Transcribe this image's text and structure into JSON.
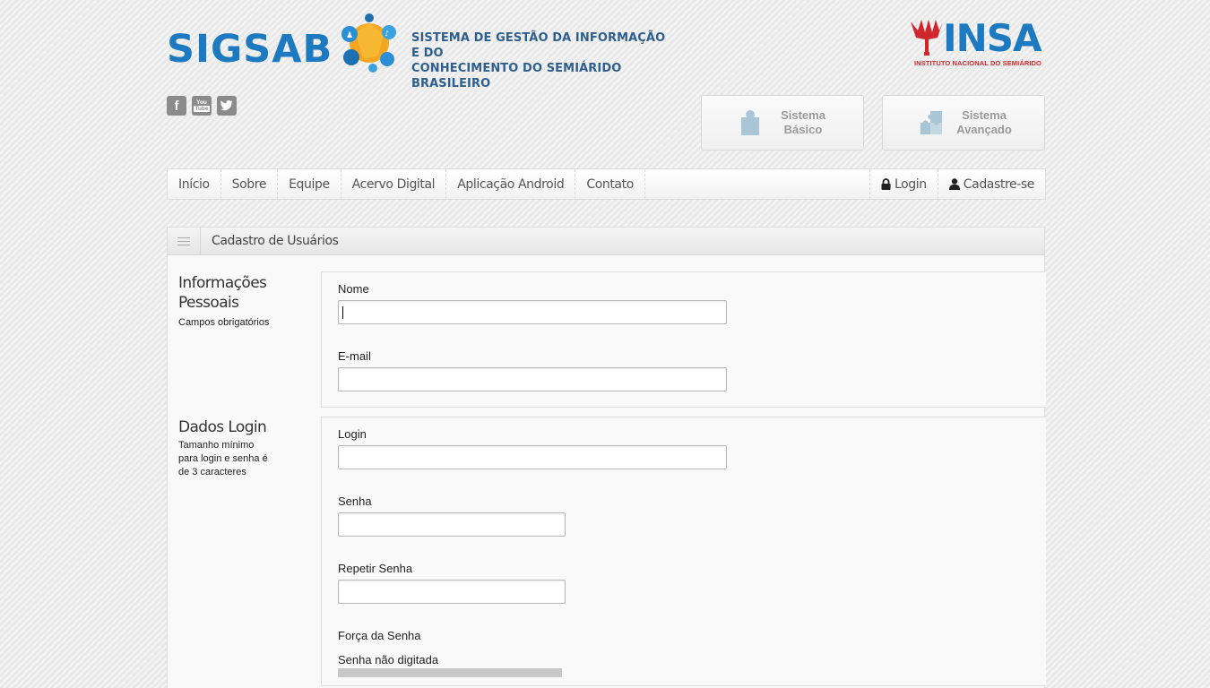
{
  "header": {
    "logo_text": "SIGSAB",
    "logo_subtitle_line1": "SISTEMA DE GESTÃO DA INFORMAÇÃO E DO",
    "logo_subtitle_line2": "CONHECIMENTO DO SEMIÁRIDO BRASILEIRO",
    "insa_text": "INSA",
    "insa_subtitle": "INSTITUTO NACIONAL DO SEMIÁRIDO"
  },
  "social": [
    {
      "icon": "facebook-icon",
      "glyph": "f"
    },
    {
      "icon": "youtube-icon",
      "glyph": "You\nTube"
    },
    {
      "icon": "twitter-icon",
      "glyph": "t"
    }
  ],
  "systems": {
    "basic_line1": "Sistema",
    "basic_line2": "Básico",
    "advanced_line1": "Sistema",
    "advanced_line2": "Avançado"
  },
  "nav": {
    "items": [
      "Início",
      "Sobre",
      "Equipe",
      "Acervo Digital",
      "Aplicação Android",
      "Contato"
    ],
    "login": "Login",
    "register": "Cadastre-se"
  },
  "panel": {
    "title": "Cadastro de Usuários"
  },
  "personal": {
    "heading_line1": "Informações",
    "heading_line2": "Pessoais",
    "note": "Campos obrigatórios",
    "name_label": "Nome",
    "name_value": "",
    "email_label": "E-mail",
    "email_value": ""
  },
  "login_data": {
    "heading": "Dados Login",
    "note_line1": "Tamanho mínimo",
    "note_line2": "para login e senha é",
    "note_line3": "de 3 caracteres",
    "login_label": "Login",
    "login_value": "",
    "password_label": "Senha",
    "password_value": "",
    "repeat_label": "Repetir Senha",
    "repeat_value": "",
    "strength_label": "Força da Senha",
    "strength_status": "Senha não digitada",
    "strength_fraction": 0
  },
  "colors": {
    "brand_blue": "#1d7ac0",
    "insa_red": "#d0272c",
    "puzzle_blue": "#a9c6d6"
  }
}
